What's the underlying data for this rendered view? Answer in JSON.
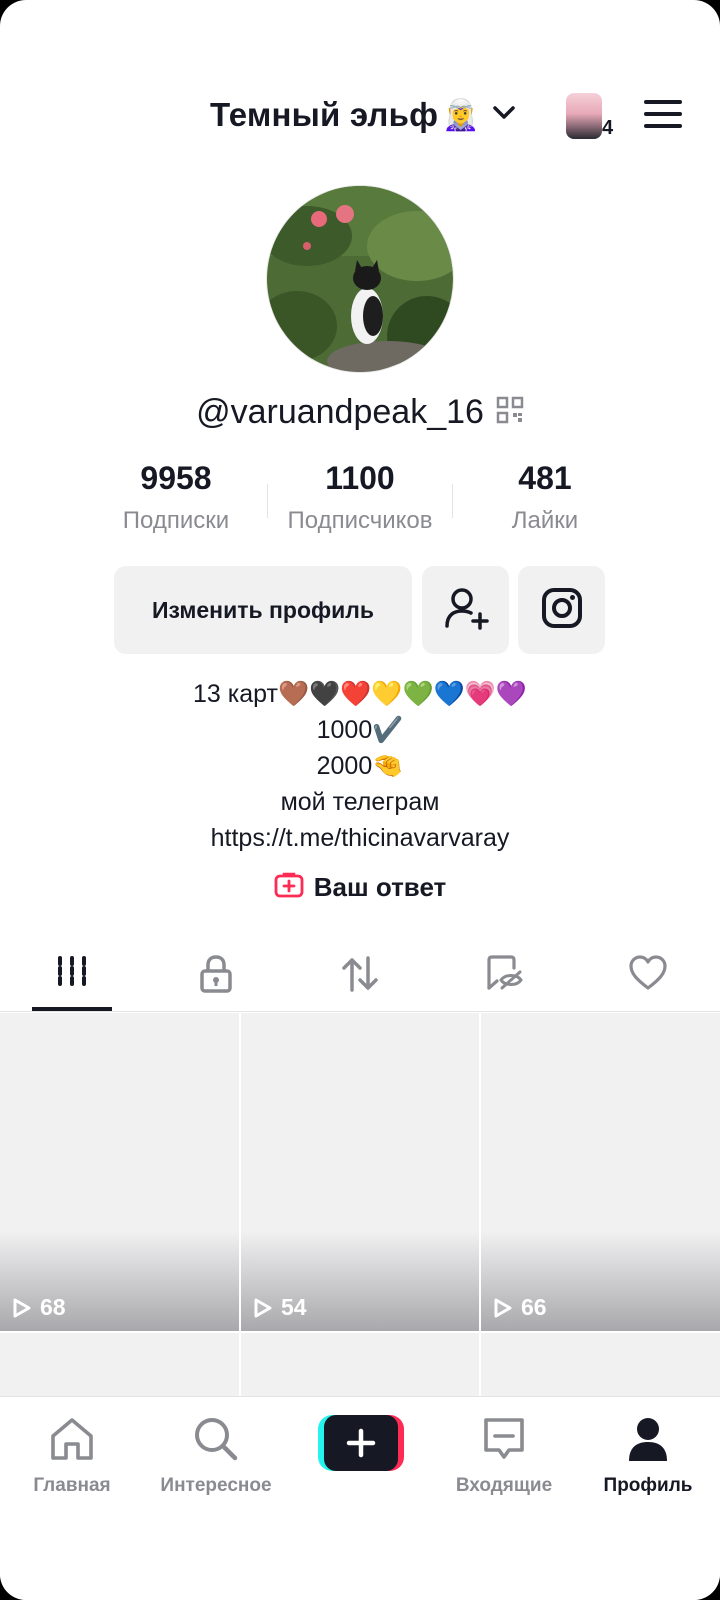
{
  "header": {
    "account_name": "Темный эльф",
    "account_emoji": "🧝‍♀️",
    "story_count": "4",
    "icons": [
      "chevron-down-icon",
      "menu-icon"
    ]
  },
  "profile": {
    "handle": "@varuandpeak_16",
    "stats": [
      {
        "value": "9958",
        "label": "Подписки"
      },
      {
        "value": "1100",
        "label": "Подписчиков"
      },
      {
        "value": "481",
        "label": "Лайки"
      }
    ],
    "edit_button": "Изменить профиль",
    "bio": [
      "13 карт🤎🖤❤️💛💚💙💗💜",
      "1000✔️",
      "2000🤏",
      "мой телеграм",
      "https://t.me/thicinavarvaray"
    ],
    "answer_label": "Ваш ответ"
  },
  "tabs": [
    "videos-icon",
    "private-lock-icon",
    "reposts-icon",
    "hidden-icon",
    "liked-heart-icon"
  ],
  "videos": [
    {
      "views": "68"
    },
    {
      "views": "54"
    },
    {
      "views": "66"
    }
  ],
  "nav": {
    "home": "Главная",
    "discover": "Интересное",
    "inbox": "Входящие",
    "profile": "Профиль"
  },
  "colors": {
    "text": "#161823",
    "muted": "#8a8b91",
    "button_bg": "#f1f1f2",
    "accent_red": "#fe2c55",
    "accent_cyan": "#25f4ee"
  }
}
